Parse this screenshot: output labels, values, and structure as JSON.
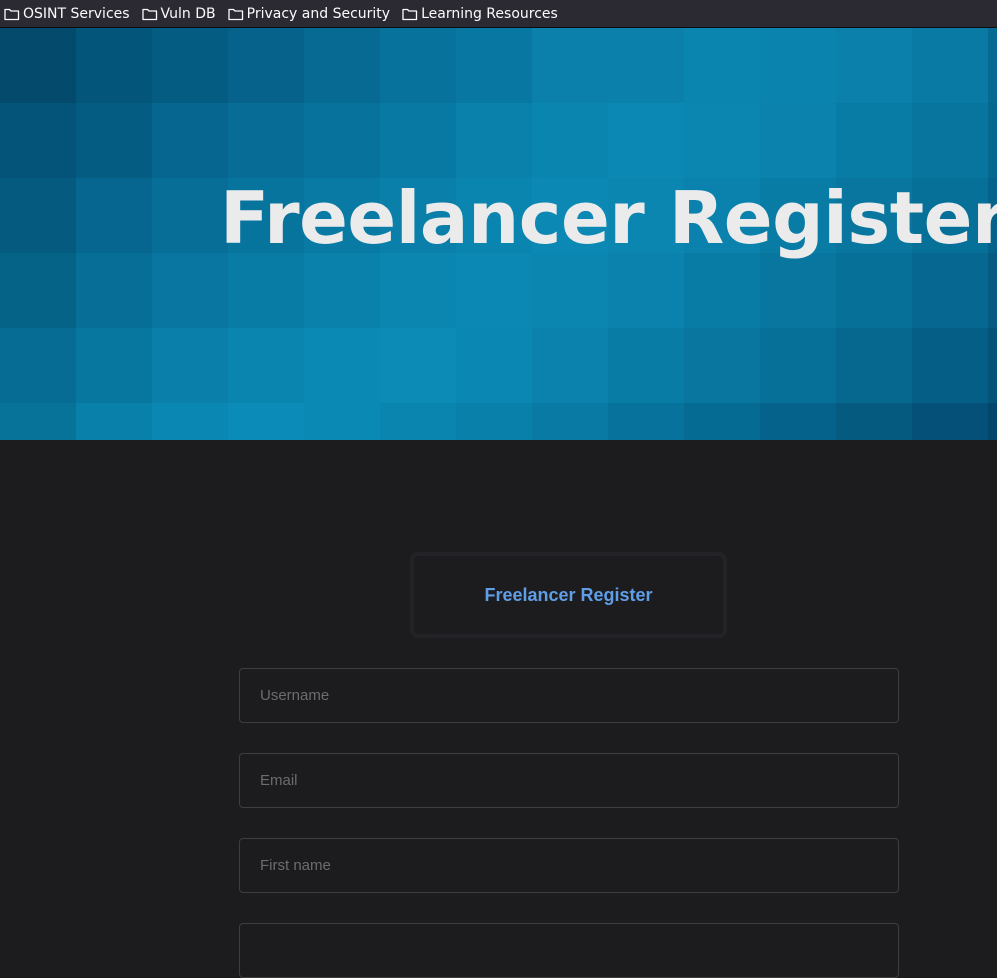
{
  "bookmarks": [
    {
      "label": "OSINT Services",
      "icon": "folder-icon"
    },
    {
      "label": "Vuln DB",
      "icon": "folder-icon"
    },
    {
      "label": "Privacy and Security",
      "icon": "folder-icon"
    },
    {
      "label": "Learning Resources",
      "icon": "folder-icon"
    }
  ],
  "hero": {
    "title": "Freelancer Register"
  },
  "form": {
    "heading": "Freelancer Register",
    "fields": [
      {
        "name": "username",
        "placeholder": "Username",
        "value": ""
      },
      {
        "name": "email",
        "placeholder": "Email",
        "value": ""
      },
      {
        "name": "first_name",
        "placeholder": "First name",
        "value": ""
      },
      {
        "name": "last_name",
        "placeholder": "",
        "value": ""
      }
    ]
  },
  "colors": {
    "hero_base": "#0a7aa6",
    "accent_heading": "#5f9ee6",
    "page_background": "#1c1c1f",
    "bookmarks_bar": "#2b2a33"
  }
}
